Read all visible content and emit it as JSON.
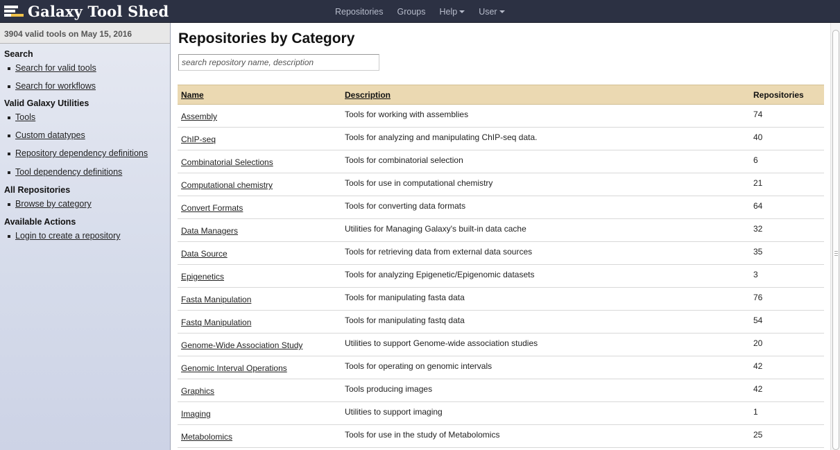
{
  "brand": {
    "title": "Galaxy Tool Shed"
  },
  "nav": {
    "repositories": "Repositories",
    "groups": "Groups",
    "help": "Help",
    "user": "User"
  },
  "sidebar": {
    "header": "3904 valid tools on May 15, 2016",
    "search_title": "Search",
    "search_valid_tools": "Search for valid tools",
    "search_workflows": "Search for workflows",
    "utilities_title": "Valid Galaxy Utilities",
    "tools": "Tools",
    "custom_datatypes": "Custom datatypes",
    "repo_dep_defs": "Repository dependency definitions",
    "tool_dep_defs": "Tool dependency definitions",
    "all_repos_title": "All Repositories",
    "browse_by_category": "Browse by category",
    "actions_title": "Available Actions",
    "login": "Login to create a repository"
  },
  "main": {
    "title": "Repositories by Category",
    "search_placeholder": "search repository name, description",
    "columns": {
      "name": "Name",
      "description": "Description",
      "repositories": "Repositories"
    },
    "rows": [
      {
        "name": "Assembly",
        "description": "Tools for working with assemblies",
        "count": "74"
      },
      {
        "name": "ChIP-seq",
        "description": "Tools for analyzing and manipulating ChIP-seq data.",
        "count": "40"
      },
      {
        "name": "Combinatorial Selections",
        "description": "Tools for combinatorial selection",
        "count": "6"
      },
      {
        "name": "Computational chemistry",
        "description": "Tools for use in computational chemistry",
        "count": "21"
      },
      {
        "name": "Convert Formats",
        "description": "Tools for converting data formats",
        "count": "64"
      },
      {
        "name": "Data Managers",
        "description": "Utilities for Managing Galaxy's built-in data cache",
        "count": "32"
      },
      {
        "name": "Data Source",
        "description": "Tools for retrieving data from external data sources",
        "count": "35"
      },
      {
        "name": "Epigenetics",
        "description": "Tools for analyzing Epigenetic/Epigenomic datasets",
        "count": "3"
      },
      {
        "name": "Fasta Manipulation",
        "description": "Tools for manipulating fasta data",
        "count": "76"
      },
      {
        "name": "Fastq Manipulation",
        "description": "Tools for manipulating fastq data",
        "count": "54"
      },
      {
        "name": "Genome-Wide Association Study",
        "description": "Utilities to support Genome-wide association studies",
        "count": "20"
      },
      {
        "name": "Genomic Interval Operations",
        "description": "Tools for operating on genomic intervals",
        "count": "42"
      },
      {
        "name": "Graphics",
        "description": "Tools producing images",
        "count": "42"
      },
      {
        "name": "Imaging",
        "description": "Utilities to support imaging",
        "count": "1"
      },
      {
        "name": "Metabolomics",
        "description": "Tools for use in the study of Metabolomics",
        "count": "25"
      }
    ]
  }
}
